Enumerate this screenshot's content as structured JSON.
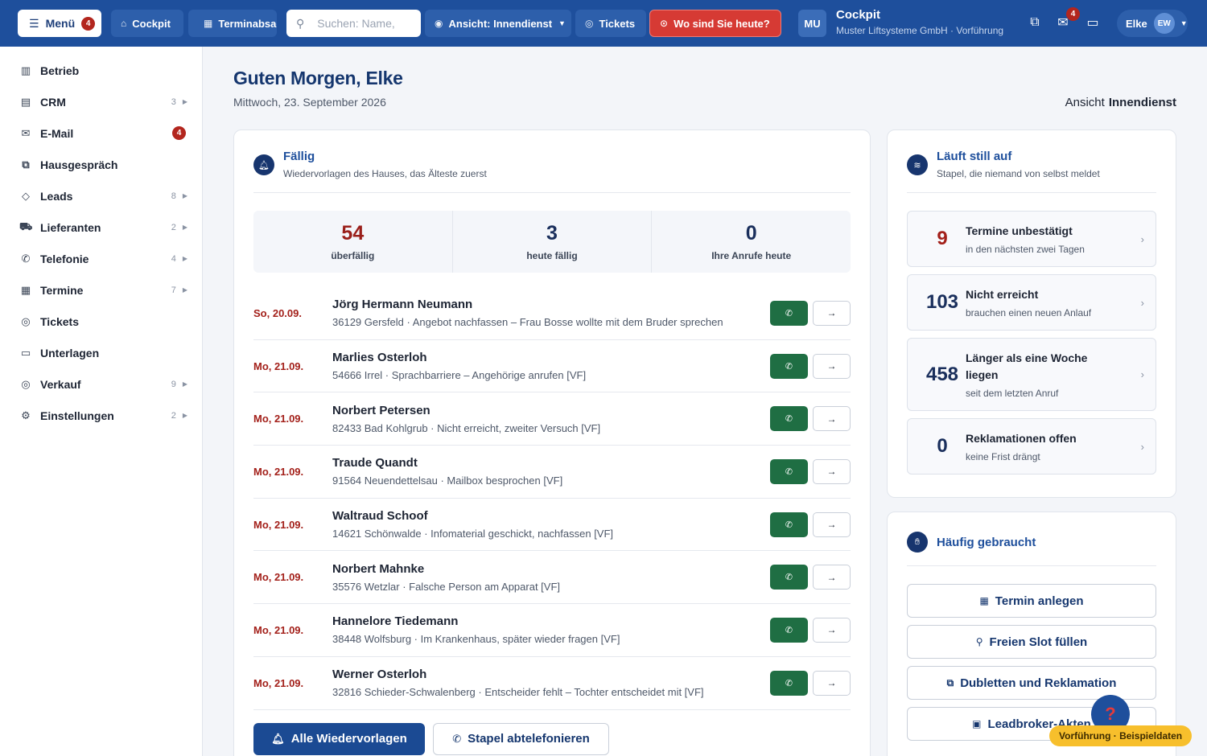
{
  "topbar": {
    "menu_label": "Menü",
    "menu_badge": "4",
    "cockpit_label": "Cockpit",
    "termin_label": "Terminabsage",
    "search_placeholder": "Suchen: Name,",
    "ansicht_label": "Ansicht: Innendienst",
    "tickets_label": "Tickets",
    "wo_label": "Wo sind Sie heute?",
    "org_initials": "MU",
    "context_title": "Cockpit",
    "context_sub": "Muster Liftsysteme GmbH · Vorführung",
    "inbox_badge": "4",
    "user_name": "Elke",
    "user_initials": "EW"
  },
  "sidebar": {
    "items": [
      {
        "label": "Betrieb",
        "count": "",
        "icon": "building-icon"
      },
      {
        "label": "CRM",
        "count": "3",
        "icon": "contacts-icon"
      },
      {
        "label": "E-Mail",
        "badge": "4",
        "icon": "mail-icon"
      },
      {
        "label": "Hausgespräch",
        "count": "",
        "icon": "chat-icon"
      },
      {
        "label": "Leads",
        "count": "8",
        "icon": "tag-icon"
      },
      {
        "label": "Lieferanten",
        "count": "2",
        "icon": "truck-icon"
      },
      {
        "label": "Telefonie",
        "count": "4",
        "icon": "phone-icon"
      },
      {
        "label": "Termine",
        "count": "7",
        "icon": "calendar-icon"
      },
      {
        "label": "Tickets",
        "count": "",
        "icon": "lifebuoy-icon"
      },
      {
        "label": "Unterlagen",
        "count": "",
        "icon": "folder-icon"
      },
      {
        "label": "Verkauf",
        "count": "9",
        "icon": "target-icon"
      },
      {
        "label": "Einstellungen",
        "count": "2",
        "icon": "gear-icon"
      }
    ]
  },
  "header": {
    "greeting": "Guten Morgen, Elke",
    "date": "Mittwoch, 23. September 2026",
    "view_label": "Ansicht",
    "view_value": "Innendienst"
  },
  "faellig": {
    "title": "Fällig",
    "subtitle": "Wiedervorlagen des Hauses, das Älteste zuerst",
    "stats": [
      {
        "value": "54",
        "label": "überfällig"
      },
      {
        "value": "3",
        "label": "heute fällig"
      },
      {
        "value": "0",
        "label": "Ihre Anrufe heute"
      }
    ],
    "rows": [
      {
        "date": "So, 20.09.",
        "name": "Jörg Hermann Neumann",
        "detail": "36129 Gersfeld · Angebot nachfassen – Frau Bosse wollte mit dem Bruder sprechen"
      },
      {
        "date": "Mo, 21.09.",
        "name": "Marlies Osterloh",
        "detail": "54666 Irrel · Sprachbarriere – Angehörige anrufen [VF]"
      },
      {
        "date": "Mo, 21.09.",
        "name": "Norbert Petersen",
        "detail": "82433 Bad Kohlgrub · Nicht erreicht, zweiter Versuch [VF]"
      },
      {
        "date": "Mo, 21.09.",
        "name": "Traude Quandt",
        "detail": "91564 Neuendettelsau · Mailbox besprochen [VF]"
      },
      {
        "date": "Mo, 21.09.",
        "name": "Waltraud Schoof",
        "detail": "14621 Schönwalde · Infomaterial geschickt, nachfassen [VF]"
      },
      {
        "date": "Mo, 21.09.",
        "name": "Norbert Mahnke",
        "detail": "35576 Wetzlar · Falsche Person am Apparat [VF]"
      },
      {
        "date": "Mo, 21.09.",
        "name": "Hannelore Tiedemann",
        "detail": "38448 Wolfsburg · Im Krankenhaus, später wieder fragen [VF]"
      },
      {
        "date": "Mo, 21.09.",
        "name": "Werner Osterloh",
        "detail": "32816 Schieder-Schwalenberg · Entscheider fehlt – Tochter entscheidet mit [VF]"
      }
    ],
    "btn_all": "Alle Wiedervorlagen",
    "btn_batch": "Stapel abtelefonieren"
  },
  "still": {
    "title": "Läuft still auf",
    "subtitle": "Stapel, die niemand von selbst meldet",
    "items": [
      {
        "value": "9",
        "title": "Termine unbestätigt",
        "sub": "in den nächsten zwei Tagen"
      },
      {
        "value": "103",
        "title": "Nicht erreicht",
        "sub": "brauchen einen neuen Anlauf"
      },
      {
        "value": "458",
        "title": "Länger als eine Woche liegen",
        "sub": "seit dem letzten Anruf"
      },
      {
        "value": "0",
        "title": "Reklamationen offen",
        "sub": "keine Frist drängt"
      }
    ]
  },
  "haeufig": {
    "title": "Häufig gebraucht",
    "items": [
      {
        "label": "Termin anlegen"
      },
      {
        "label": "Freien Slot füllen"
      },
      {
        "label": "Dubletten und Reklamation"
      },
      {
        "label": "Leadbroker-Akten"
      }
    ]
  },
  "help_glyph": "?",
  "demo_label": "Vorführung · Beispieldaten",
  "colors": {
    "brand": "#1e4f9c",
    "alert": "#d63a34",
    "call": "#1f6e43",
    "overdue": "#a3201a"
  }
}
